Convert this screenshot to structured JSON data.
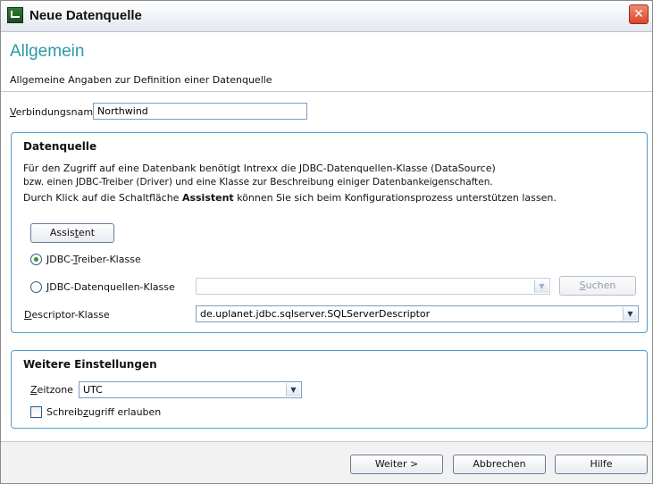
{
  "window": {
    "title": "Neue Datenquelle",
    "close_glyph": "✕"
  },
  "header": {
    "title": "Allgemein",
    "subtitle": "Allgemeine Angaben zur Definition einer Datenquelle"
  },
  "connection": {
    "label_accel": "V",
    "label_rest": "erbindungsname",
    "value": "Northwind"
  },
  "datasource": {
    "title": "Datenquelle",
    "line1": "Für den Zugriff auf eine Datenbank benötigt Intrexx die JDBC-Datenquellen-Klasse (DataSource)",
    "line2": "bzw. einen JDBC-Treiber (Driver) und eine Klasse zur Beschreibung einiger Datenbankeigenschaften.",
    "line3_pre": "Durch Klick auf die Schaltfläche ",
    "line3_bold": "Assistent",
    "line3_post": " können Sie sich beim Konfigurationsprozess unterstützen lassen.",
    "assistant_button": {
      "pre": "Assis",
      "accel": "t",
      "post": "ent"
    },
    "driver_radio": {
      "pre": "JDBC-",
      "accel": "T",
      "post": "reiber-Klasse",
      "checked": true
    },
    "datasource_radio": {
      "pre": "",
      "accel": "J",
      "post": "DBC-Datenquellen-Klasse",
      "checked": false
    },
    "datasource_combo_value": "",
    "search_button": {
      "accel": "S",
      "post": "uchen"
    },
    "descriptor": {
      "label_accel": "D",
      "label_rest": "escriptor-Klasse",
      "value": "de.uplanet.jdbc.sqlserver.SQLServerDescriptor"
    }
  },
  "more_settings": {
    "title": "Weitere Einstellungen",
    "timezone": {
      "label_accel": "Z",
      "label_rest": "eitzone",
      "value": "UTC"
    },
    "write_access": {
      "pre": "Schreib",
      "accel": "z",
      "post": "ugriff erlauben",
      "checked": false
    }
  },
  "footer": {
    "next": "Weiter >",
    "cancel": "Abbrechen",
    "help": "Hilfe"
  },
  "icons": {
    "app": "app-window-icon",
    "close": "close-icon",
    "dropdown": "chevron-down-icon"
  },
  "colors": {
    "heading": "#2a9aa6",
    "section_border": "#4a9fd0",
    "close_button": "#d9452b",
    "radio_dot": "#2e9a30"
  }
}
